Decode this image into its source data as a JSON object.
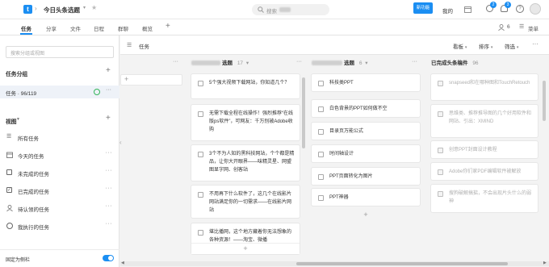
{
  "topbar": {
    "app_icon": "app-logo-t",
    "title": "今日头条选题",
    "search_placeholder": "搜索",
    "new_badge": "新功能",
    "user_label": "我的",
    "notification_count": "2",
    "alert_count": "3",
    "star_icon": "star-icon"
  },
  "tabs": [
    {
      "label": "任务"
    },
    {
      "label": "分享"
    },
    {
      "label": "文件"
    },
    {
      "label": "日程"
    },
    {
      "label": "群聊"
    },
    {
      "label": "概览"
    }
  ],
  "tabbar_right": {
    "member_count": "6",
    "menu_label": "菜单"
  },
  "sidebar": {
    "search_placeholder": "搜索分组或视图",
    "groups_title": "任务分组",
    "group_item": {
      "label": "任务 · 96/119"
    },
    "views_title": "视图",
    "views": [
      {
        "label": "所有任务",
        "icon": "list-icon"
      },
      {
        "label": "今天的任务",
        "icon": "calendar-icon"
      },
      {
        "label": "未完成的任务",
        "icon": "checkbox-empty-icon"
      },
      {
        "label": "已完成的任务",
        "icon": "checkbox-checked-icon"
      },
      {
        "label": "待认领的任务",
        "icon": "person-icon"
      },
      {
        "label": "我执行的任务",
        "icon": "person-circle-icon"
      }
    ],
    "pin_label": "固定为侧栏",
    "pin_on": true
  },
  "board_head": {
    "title": "任务",
    "view_btn": "看板",
    "sort_btn": "排序",
    "filter_btn": "筛选"
  },
  "columns": [
    {
      "title": "选题",
      "count": "17",
      "cards": [
        {
          "text": "5个强大视频下载网站，你知道几个？"
        },
        {
          "text": "无需下载全程在线操作！强烈推荐“在线版ps软件”，可网友：千万别被Adobe收购"
        },
        {
          "text": "3个不为人知的黑科技网站，个个都是精品，让你大开眼界——味精灵星、网盟图显字网、创客站"
        },
        {
          "text": "不用再下什么软件了，这几个在线影片网站满足你的一切需求——在线影片网站"
        },
        {
          "text": "堪比播网，这个地方藏着你无法想象的各种资源！——淘宝、微播"
        }
      ]
    },
    {
      "title": "选题",
      "count": "6",
      "cards": [
        {
          "text": "科技类PPT"
        },
        {
          "text": "白色背景的PPT如何做不空"
        },
        {
          "text": "目录页万能公式"
        },
        {
          "text": "时间轴设计"
        },
        {
          "text": "PPT页面转化为图片"
        },
        {
          "text": "PPT神器"
        }
      ]
    },
    {
      "title": "已完成头条稿件",
      "count": "96",
      "cards": [
        {
          "text": "snapseed和在哪种图和TouchRetouch"
        },
        {
          "text": "思维类、推荐推导图的几个好用软件和网站、引出：XMIND"
        },
        {
          "text": "创意PPT封面设计教程"
        },
        {
          "text": "Adobe你们家PDF编辑软件被解放"
        },
        {
          "text": "搜狗破解搞掂，不会出现片头什么的弱神"
        }
      ]
    }
  ]
}
